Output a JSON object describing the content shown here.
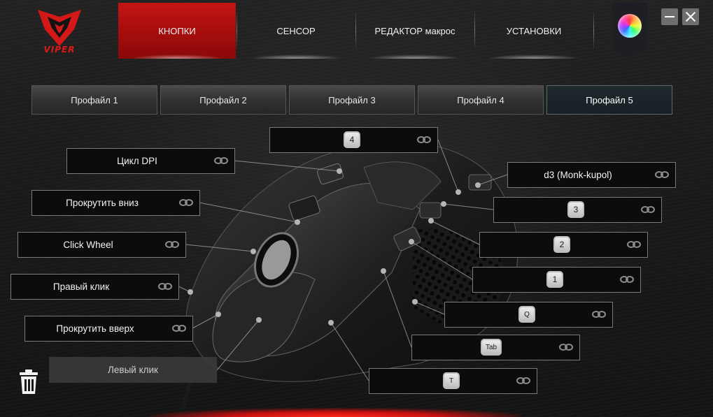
{
  "brand": {
    "logo_text": "VIPER"
  },
  "nav": {
    "tabs": [
      {
        "label": "КНОПКИ",
        "active": true
      },
      {
        "label": "СЕНСОР",
        "active": false
      },
      {
        "label": "РЕДАКТОР макрос",
        "active": false
      },
      {
        "label": "УСТАНОВКИ",
        "active": false
      }
    ],
    "lighting_icon": "color-wheel-icon"
  },
  "window_controls": {
    "minimize_icon": "minimize-icon",
    "close_icon": "close-icon"
  },
  "profiles": [
    {
      "label": "Профайл 1",
      "active": false
    },
    {
      "label": "Профайл 2",
      "active": false
    },
    {
      "label": "Профайл 3",
      "active": false
    },
    {
      "label": "Профайл 4",
      "active": false
    },
    {
      "label": "Профайл 5",
      "active": true
    }
  ],
  "buttons_left": [
    {
      "label": "Цикл DPI"
    },
    {
      "label": "Прокрутить вниз"
    },
    {
      "label": "Click Wheel"
    },
    {
      "label": "Правый клик"
    },
    {
      "label": "Прокрутить вверх"
    }
  ],
  "left_click": {
    "label": "Левый клик"
  },
  "buttons_right": [
    {
      "key": "4"
    },
    {
      "label": "d3 (Monk-kupol)"
    },
    {
      "key": "3"
    },
    {
      "key": "2"
    },
    {
      "key": "1"
    },
    {
      "key": "Q"
    },
    {
      "key": "Tab"
    },
    {
      "key": "T"
    }
  ],
  "icons": {
    "link": "link-icon",
    "trash": "trash-icon"
  },
  "colors": {
    "accent_red": "#c41414",
    "active_profile": "#1f2a2e"
  }
}
